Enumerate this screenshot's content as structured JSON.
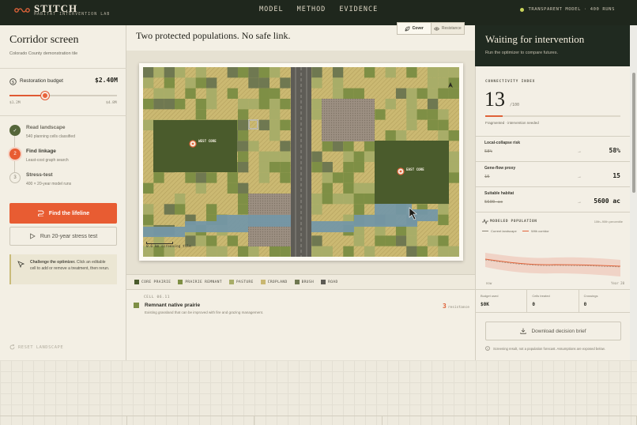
{
  "header": {
    "brand": "STITCH",
    "brand_sub": "HABITAT INTERVENTION LAB",
    "nav": [
      "MODEL",
      "METHOD",
      "EVIDENCE"
    ],
    "status": "TRANSPARENT MODEL · 400 RUNS"
  },
  "left": {
    "title": "Corridor screen",
    "subtitle": "Colorado County demonstration tile",
    "budget": {
      "label": "Restoration budget",
      "value": "$2.40M",
      "min": "$1.2M",
      "max": "$4.8M",
      "fraction": 0.33
    },
    "steps": [
      {
        "num": "✓",
        "title": "Read landscape",
        "desc": "540 planning cells classified",
        "state": "done"
      },
      {
        "num": "2",
        "title": "Find linkage",
        "desc": "Least-cost graph search",
        "state": "active"
      },
      {
        "num": "3",
        "title": "Stress-test",
        "desc": "400 × 20-year model runs",
        "state": "pending"
      }
    ],
    "primary_button": "Find the lifeline",
    "secondary_button": "Run 20-year stress test",
    "challenge_title": "Challenge the optimizer.",
    "challenge_text": " Click an editable cell to add or remove a treatment, then rerun.",
    "reset": "RESET LANDSCAPE"
  },
  "center": {
    "title": "Two protected populations. No safe link.",
    "toggle": [
      "Cover",
      "Resistance"
    ],
    "map": {
      "west_label": "WEST CORE",
      "east_label": "EAST CORE",
      "scale": "0.6 km screening tile",
      "colors": {
        "core": "#4a5b2c",
        "remnant": "#7e8f45",
        "pasture": "#a8ad68",
        "cropland": "#c9b770",
        "brush": "#6f7851",
        "road": "#5d5b55",
        "water": "#7497a6",
        "town": "#9b8e80"
      }
    },
    "legend": [
      "CORE PRAIRIE",
      "PRAIRIE REMNANT",
      "PASTURE",
      "CROPLAND",
      "BRUSH",
      "ROAD"
    ],
    "cell": {
      "id": "CELL 06.11",
      "name": "Remnant native prairie",
      "desc": "Existing grassland that can be improved with fire and grazing management.",
      "resistance": "3",
      "resistance_label": "resistance"
    }
  },
  "right": {
    "title": "Waiting for intervention",
    "subtitle": "Run the optimizer to compare futures.",
    "connectivity_label": "CONNECTIVITY INDEX",
    "connectivity_value": "13",
    "connectivity_max": "/100",
    "connectivity_note": "Fragmented · intervention needed",
    "metrics": [
      {
        "label": "Local-collapse risk",
        "before": "58%",
        "after": "58%"
      },
      {
        "label": "Gene-flow proxy",
        "before": "15",
        "after": "15"
      },
      {
        "label": "Suitable habitat",
        "before": "5600 ac",
        "after": "5600 ac"
      }
    ],
    "population": {
      "label": "MODELED POPULATION",
      "range": "10th–90th percentile",
      "legend": [
        "Current landscape",
        "With corridor"
      ],
      "x_start": "now",
      "x_end": "Year 20"
    },
    "stats": [
      {
        "label": "Budget used",
        "value": "$0K"
      },
      {
        "label": "Cells treated",
        "value": "0"
      },
      {
        "label": "Crossings",
        "value": "0"
      }
    ],
    "download": "Download decision brief",
    "disclaimer": "Screening result, not a population forecast. Assumptions are exposed below."
  }
}
